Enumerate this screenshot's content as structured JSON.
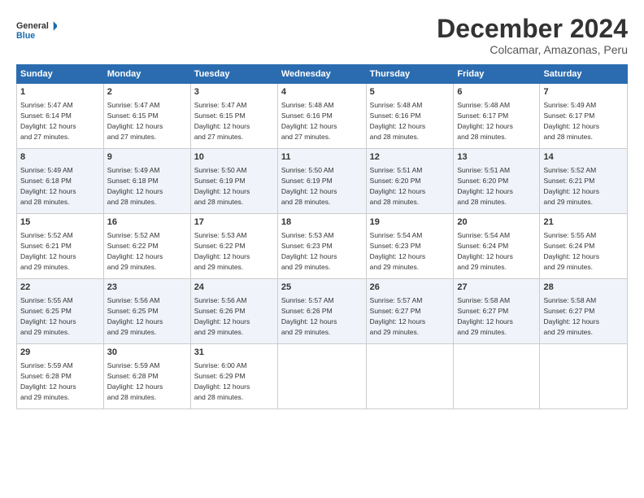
{
  "logo": {
    "line1": "General",
    "line2": "Blue"
  },
  "header": {
    "month_title": "December 2024",
    "subtitle": "Colcamar, Amazonas, Peru"
  },
  "columns": [
    "Sunday",
    "Monday",
    "Tuesday",
    "Wednesday",
    "Thursday",
    "Friday",
    "Saturday"
  ],
  "weeks": [
    [
      {
        "day": "1",
        "detail": "Sunrise: 5:47 AM\nSunset: 6:14 PM\nDaylight: 12 hours\nand 27 minutes."
      },
      {
        "day": "2",
        "detail": "Sunrise: 5:47 AM\nSunset: 6:15 PM\nDaylight: 12 hours\nand 27 minutes."
      },
      {
        "day": "3",
        "detail": "Sunrise: 5:47 AM\nSunset: 6:15 PM\nDaylight: 12 hours\nand 27 minutes."
      },
      {
        "day": "4",
        "detail": "Sunrise: 5:48 AM\nSunset: 6:16 PM\nDaylight: 12 hours\nand 27 minutes."
      },
      {
        "day": "5",
        "detail": "Sunrise: 5:48 AM\nSunset: 6:16 PM\nDaylight: 12 hours\nand 28 minutes."
      },
      {
        "day": "6",
        "detail": "Sunrise: 5:48 AM\nSunset: 6:17 PM\nDaylight: 12 hours\nand 28 minutes."
      },
      {
        "day": "7",
        "detail": "Sunrise: 5:49 AM\nSunset: 6:17 PM\nDaylight: 12 hours\nand 28 minutes."
      }
    ],
    [
      {
        "day": "8",
        "detail": "Sunrise: 5:49 AM\nSunset: 6:18 PM\nDaylight: 12 hours\nand 28 minutes."
      },
      {
        "day": "9",
        "detail": "Sunrise: 5:49 AM\nSunset: 6:18 PM\nDaylight: 12 hours\nand 28 minutes."
      },
      {
        "day": "10",
        "detail": "Sunrise: 5:50 AM\nSunset: 6:19 PM\nDaylight: 12 hours\nand 28 minutes."
      },
      {
        "day": "11",
        "detail": "Sunrise: 5:50 AM\nSunset: 6:19 PM\nDaylight: 12 hours\nand 28 minutes."
      },
      {
        "day": "12",
        "detail": "Sunrise: 5:51 AM\nSunset: 6:20 PM\nDaylight: 12 hours\nand 28 minutes."
      },
      {
        "day": "13",
        "detail": "Sunrise: 5:51 AM\nSunset: 6:20 PM\nDaylight: 12 hours\nand 28 minutes."
      },
      {
        "day": "14",
        "detail": "Sunrise: 5:52 AM\nSunset: 6:21 PM\nDaylight: 12 hours\nand 29 minutes."
      }
    ],
    [
      {
        "day": "15",
        "detail": "Sunrise: 5:52 AM\nSunset: 6:21 PM\nDaylight: 12 hours\nand 29 minutes."
      },
      {
        "day": "16",
        "detail": "Sunrise: 5:52 AM\nSunset: 6:22 PM\nDaylight: 12 hours\nand 29 minutes."
      },
      {
        "day": "17",
        "detail": "Sunrise: 5:53 AM\nSunset: 6:22 PM\nDaylight: 12 hours\nand 29 minutes."
      },
      {
        "day": "18",
        "detail": "Sunrise: 5:53 AM\nSunset: 6:23 PM\nDaylight: 12 hours\nand 29 minutes."
      },
      {
        "day": "19",
        "detail": "Sunrise: 5:54 AM\nSunset: 6:23 PM\nDaylight: 12 hours\nand 29 minutes."
      },
      {
        "day": "20",
        "detail": "Sunrise: 5:54 AM\nSunset: 6:24 PM\nDaylight: 12 hours\nand 29 minutes."
      },
      {
        "day": "21",
        "detail": "Sunrise: 5:55 AM\nSunset: 6:24 PM\nDaylight: 12 hours\nand 29 minutes."
      }
    ],
    [
      {
        "day": "22",
        "detail": "Sunrise: 5:55 AM\nSunset: 6:25 PM\nDaylight: 12 hours\nand 29 minutes."
      },
      {
        "day": "23",
        "detail": "Sunrise: 5:56 AM\nSunset: 6:25 PM\nDaylight: 12 hours\nand 29 minutes."
      },
      {
        "day": "24",
        "detail": "Sunrise: 5:56 AM\nSunset: 6:26 PM\nDaylight: 12 hours\nand 29 minutes."
      },
      {
        "day": "25",
        "detail": "Sunrise: 5:57 AM\nSunset: 6:26 PM\nDaylight: 12 hours\nand 29 minutes."
      },
      {
        "day": "26",
        "detail": "Sunrise: 5:57 AM\nSunset: 6:27 PM\nDaylight: 12 hours\nand 29 minutes."
      },
      {
        "day": "27",
        "detail": "Sunrise: 5:58 AM\nSunset: 6:27 PM\nDaylight: 12 hours\nand 29 minutes."
      },
      {
        "day": "28",
        "detail": "Sunrise: 5:58 AM\nSunset: 6:27 PM\nDaylight: 12 hours\nand 29 minutes."
      }
    ],
    [
      {
        "day": "29",
        "detail": "Sunrise: 5:59 AM\nSunset: 6:28 PM\nDaylight: 12 hours\nand 29 minutes."
      },
      {
        "day": "30",
        "detail": "Sunrise: 5:59 AM\nSunset: 6:28 PM\nDaylight: 12 hours\nand 28 minutes."
      },
      {
        "day": "31",
        "detail": "Sunrise: 6:00 AM\nSunset: 6:29 PM\nDaylight: 12 hours\nand 28 minutes."
      },
      {
        "day": "",
        "detail": ""
      },
      {
        "day": "",
        "detail": ""
      },
      {
        "day": "",
        "detail": ""
      },
      {
        "day": "",
        "detail": ""
      }
    ]
  ]
}
